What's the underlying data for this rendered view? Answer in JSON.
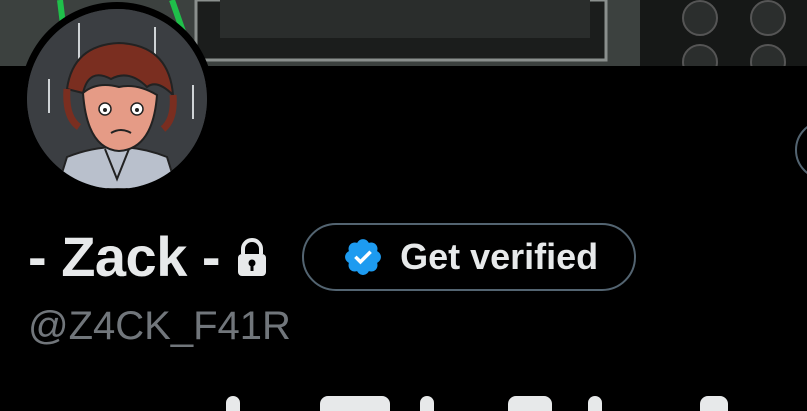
{
  "profile": {
    "display_name": "- Zack -",
    "handle": "@Z4CK_F41R",
    "protected_icon": "lock-icon",
    "avatar_icon": "avatar"
  },
  "actions": {
    "get_verified_label": "Get verified",
    "verified_badge_icon": "verified-badge-icon"
  },
  "colors": {
    "background": "#000000",
    "primary_text": "#e7e9ea",
    "secondary_text": "#71767b",
    "border": "#536471",
    "verified_blue": "#1d9bf0"
  }
}
